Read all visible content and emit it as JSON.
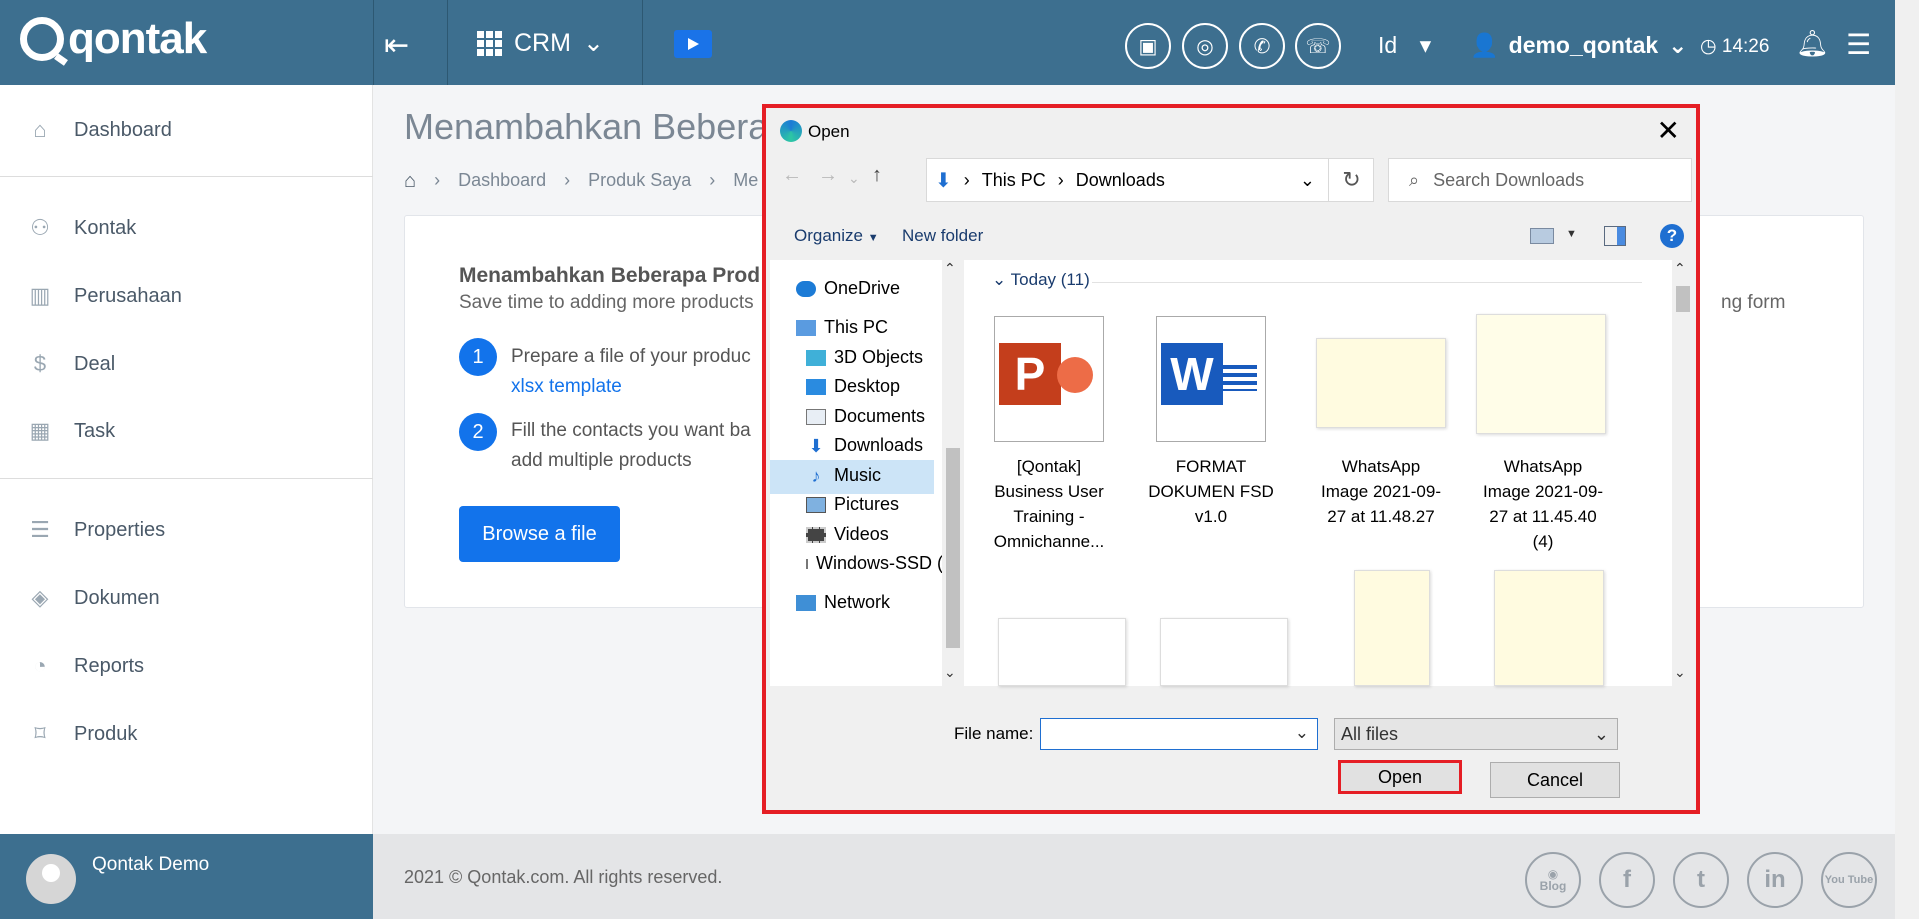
{
  "header": {
    "brand": "qontak",
    "module": "CRM",
    "lang": "Id",
    "username": "demo_qontak",
    "time": "14:26"
  },
  "sidebar": {
    "items": [
      {
        "label": "Dashboard",
        "icon": "home-icon"
      },
      {
        "label": "Kontak",
        "icon": "people-icon"
      },
      {
        "label": "Perusahaan",
        "icon": "building-icon"
      },
      {
        "label": "Deal",
        "icon": "dollar-icon"
      },
      {
        "label": "Task",
        "icon": "calendar-icon"
      },
      {
        "label": "Properties",
        "icon": "list-icon"
      },
      {
        "label": "Dokumen",
        "icon": "layers-icon"
      },
      {
        "label": "Reports",
        "icon": "pie-chart-icon"
      },
      {
        "label": "Produk",
        "icon": "tag-icon"
      }
    ],
    "user_name": "Qontak Demo"
  },
  "main": {
    "title": "Menambahkan Bebera",
    "breadcrumbs": [
      "Dashboard",
      "Produk Saya",
      "Me"
    ],
    "card_title": "Menambahkan Beberapa Prod",
    "card_subtitle": "Save time to adding more products",
    "card_tail": "ng form",
    "step1_num": "1",
    "step1_text": "Prepare a file of your produc",
    "step1_link": "xlsx template",
    "step2_num": "2",
    "step2_text": "Fill the contacts you want ba",
    "step2_text2": "add multiple products",
    "browse": "Browse a file"
  },
  "footer": {
    "copyright": "2021 © Qontak.com. All rights reserved.",
    "social": [
      "Blog",
      "f",
      "t",
      "in",
      "You Tube"
    ]
  },
  "dialog": {
    "title": "Open",
    "path": [
      "This PC",
      "Downloads"
    ],
    "search_placeholder": "Search Downloads",
    "organize": "Organize",
    "new_folder": "New folder",
    "tree": [
      "OneDrive",
      "This PC",
      "3D Objects",
      "Desktop",
      "Documents",
      "Downloads",
      "Music",
      "Pictures",
      "Videos",
      "Windows-SSD (C",
      "Network"
    ],
    "group_label": "Today (11)",
    "files": [
      {
        "name": "[Qontak] Business User Training - Omnichanne..."
      },
      {
        "name": "FORMAT DOKUMEN FSD v1.0"
      },
      {
        "name": "WhatsApp Image 2021-09-27 at 11.48.27"
      },
      {
        "name": "WhatsApp Image 2021-09-27 at 11.45.40 (4)"
      }
    ],
    "filename_label": "File name:",
    "filename_value": "",
    "filetype": "All files",
    "open": "Open",
    "cancel": "Cancel"
  },
  "colors": {
    "header_bg": "#3d6f8f",
    "accent": "#1273eb",
    "highlight": "#e51e25"
  }
}
